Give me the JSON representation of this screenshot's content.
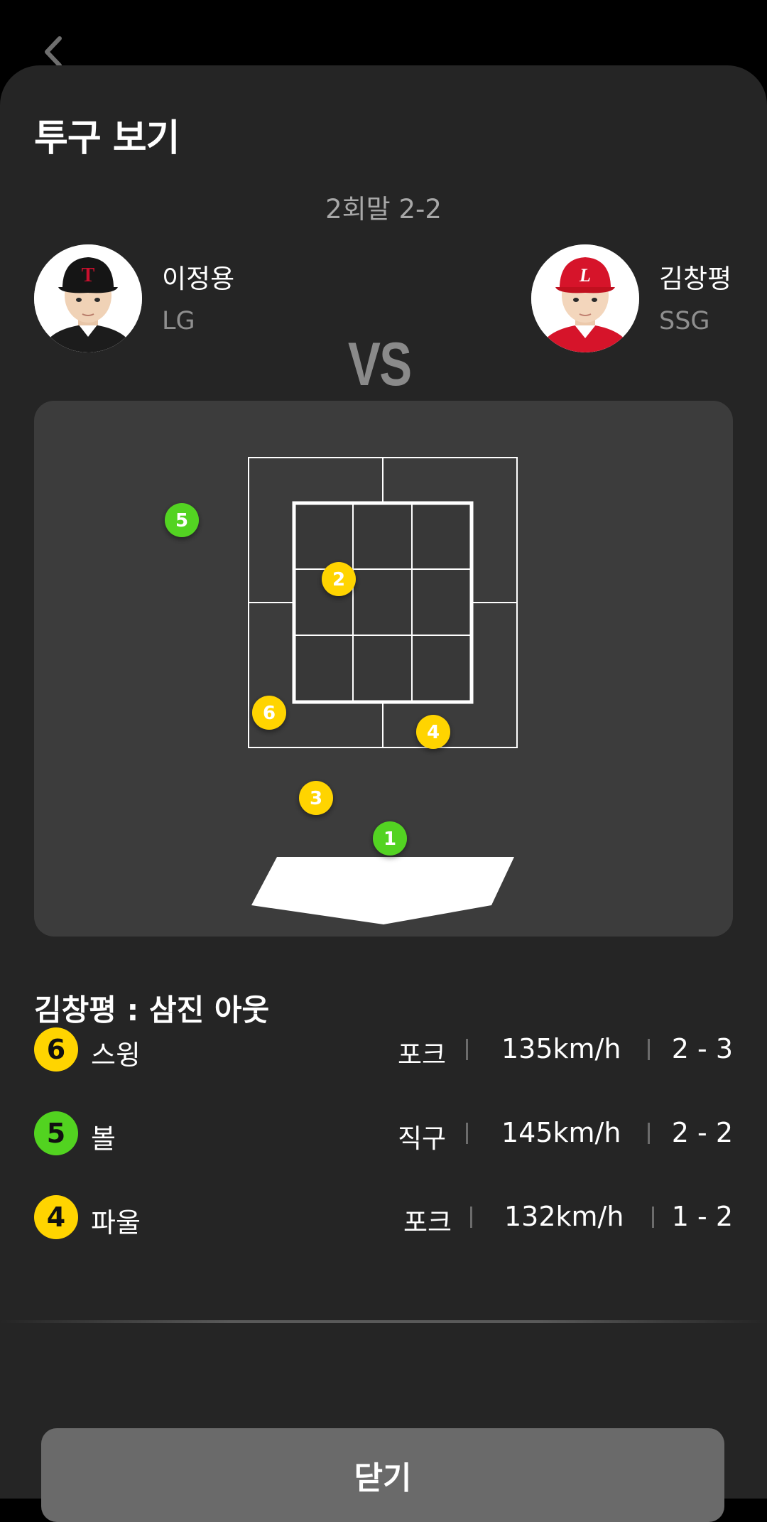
{
  "header": {
    "title": "투구 보기",
    "inning_score": "2회말 2-2"
  },
  "matchup": {
    "pitcher": {
      "name": "이정용",
      "team": "LG"
    },
    "vs_label": "VS",
    "batter": {
      "name": "김창평",
      "team": "SSG"
    }
  },
  "strike_zone": {
    "pitches": [
      {
        "number": "1",
        "color": "#52d320",
        "outcome": "ball"
      },
      {
        "number": "2",
        "color": "#ffd400",
        "outcome": "strike"
      },
      {
        "number": "3",
        "color": "#ffd400",
        "outcome": "strike"
      },
      {
        "number": "4",
        "color": "#ffd400",
        "outcome": "foul"
      },
      {
        "number": "5",
        "color": "#52d320",
        "outcome": "ball"
      },
      {
        "number": "6",
        "color": "#ffd400",
        "outcome": "swing"
      }
    ]
  },
  "result": {
    "text": "김창평 : 삼진 아웃"
  },
  "pitch_log": [
    {
      "number": "6",
      "color": "#ffd400",
      "outcome": "스윙",
      "type": "포크",
      "speed": "135km/h",
      "count": "2 - 3"
    },
    {
      "number": "5",
      "color": "#52d320",
      "outcome": "볼",
      "type": "직구",
      "speed": "145km/h",
      "count": "2 - 2"
    },
    {
      "number": "4",
      "color": "#ffd400",
      "outcome": "파울",
      "type": "포크",
      "speed": "132km/h",
      "count": "1 - 2"
    }
  ],
  "footer": {
    "close_label": "닫기"
  }
}
